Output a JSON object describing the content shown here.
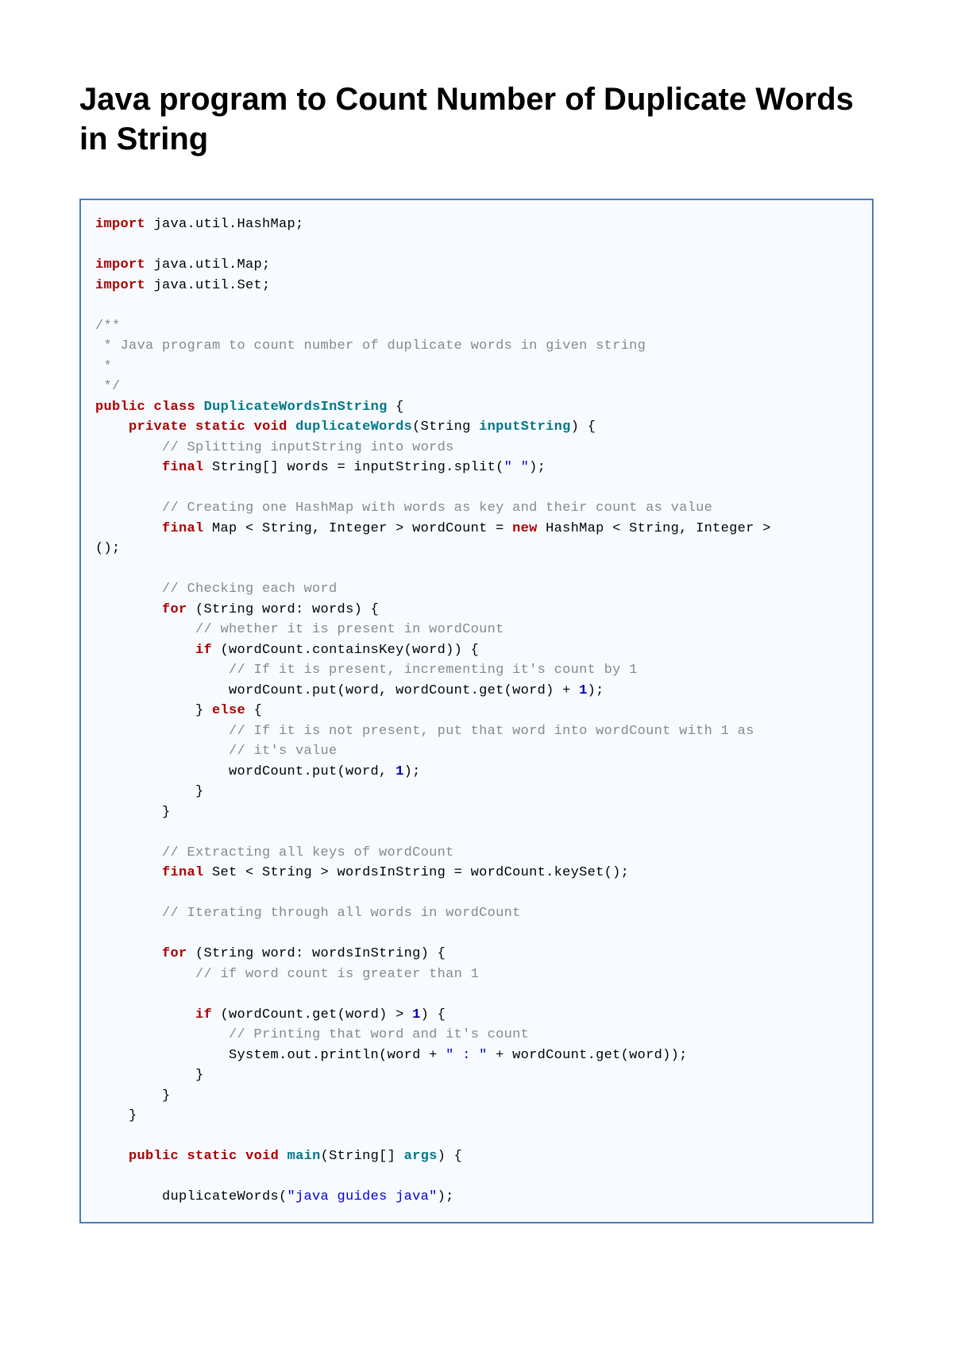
{
  "title": "Java program to Count Number of Duplicate Words in String",
  "code": {
    "l01_kw": "import",
    "l01_txt": " java.util.HashMap;",
    "l03_kw": "import",
    "l03_txt": " java.util.Map;",
    "l04_kw": "import",
    "l04_txt": " java.util.Set;",
    "l06_cm": "/**",
    "l07_cm": " * Java program to count number of duplicate words in given string",
    "l08_cm": " *",
    "l09_cm": " */",
    "l10_kw1": "public",
    "l10_kw2": "class",
    "l10_cls": "DuplicateWordsInString",
    "l10_txt": " {",
    "l11_kw1": "private",
    "l11_kw2": "static",
    "l11_kw3": "void",
    "l11_mth": "duplicateWords",
    "l11_txt1": "(String ",
    "l11_arg": "inputString",
    "l11_txt2": ") {",
    "l12_cm": "// Splitting inputString into words",
    "l13_kw": "final",
    "l13_txt1": " String[] words = inputString.split(",
    "l13_str": "\" \"",
    "l13_txt2": ");",
    "l15_cm": "// Creating one HashMap with words as key and their count as value",
    "l16_kw1": "final",
    "l16_txt1": " Map < String, Integer > wordCount = ",
    "l16_kw2": "new",
    "l16_txt2": " HashMap < String, Integer >",
    "l17_txt": "();",
    "l19_cm": "// Checking each word",
    "l20_kw": "for",
    "l20_txt": " (String word: words) {",
    "l21_cm": "// whether it is present in wordCount",
    "l22_kw": "if",
    "l22_txt": " (wordCount.containsKey(word)) {",
    "l23_cm": "// If it is present, incrementing it's count by 1",
    "l24_txt1": "wordCount.put(word, wordCount.get(word) + ",
    "l24_num": "1",
    "l24_txt2": ");",
    "l25_txt1": "} ",
    "l25_kw": "else",
    "l25_txt2": " {",
    "l26_cm": "// If it is not present, put that word into wordCount with 1 as",
    "l27_cm": "// it's value",
    "l28_txt1": "wordCount.put(word, ",
    "l28_num": "1",
    "l28_txt2": ");",
    "l29_txt": "}",
    "l30_txt": "}",
    "l32_cm": "// Extracting all keys of wordCount",
    "l33_kw": "final",
    "l33_txt": " Set < String > wordsInString = wordCount.keySet();",
    "l35_cm": "// Iterating through all words in wordCount",
    "l37_kw": "for",
    "l37_txt": " (String word: wordsInString) {",
    "l38_cm": "// if word count is greater than 1",
    "l40_kw": "if",
    "l40_txt1": " (wordCount.get(word) > ",
    "l40_num": "1",
    "l40_txt2": ") {",
    "l41_cm": "// Printing that word and it's count",
    "l42_txt1": "System.out.println(word + ",
    "l42_str": "\" : \"",
    "l42_txt2": " + wordCount.get(word));",
    "l43_txt": "}",
    "l44_txt": "}",
    "l45_txt": "}",
    "l47_kw1": "public",
    "l47_kw2": "static",
    "l47_kw3": "void",
    "l47_mth": "main",
    "l47_txt1": "(String[] ",
    "l47_arg": "args",
    "l47_txt2": ") {",
    "l49_txt1": "duplicateWords(",
    "l49_str": "\"java guides java\"",
    "l49_txt2": ");"
  }
}
